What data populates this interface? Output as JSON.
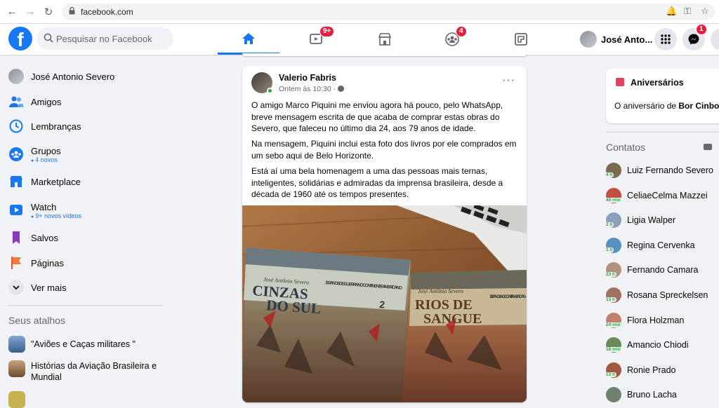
{
  "browser": {
    "url": "facebook.com"
  },
  "header": {
    "search_placeholder": "Pesquisar no Facebook",
    "watch_badge": "9+",
    "groups_badge": "4",
    "messenger_badge": "1",
    "profile_name": "José Anto..."
  },
  "sidebar": {
    "profile_name": "José Antonio Severo",
    "items": [
      {
        "label": "Amigos",
        "icon": "friends-icon"
      },
      {
        "label": "Lembranças",
        "icon": "memories-icon"
      },
      {
        "label": "Grupos",
        "sub": "4 novos",
        "icon": "groups-icon"
      },
      {
        "label": "Marketplace",
        "icon": "marketplace-icon"
      },
      {
        "label": "Watch",
        "sub": "9+ novos vídeos",
        "icon": "watch-icon"
      },
      {
        "label": "Salvos",
        "icon": "saved-icon"
      },
      {
        "label": "Páginas",
        "icon": "pages-icon"
      },
      {
        "label": "Ver mais",
        "icon": "chevron-down-icon"
      }
    ],
    "shortcuts_title": "Seus atalhos",
    "shortcuts": [
      {
        "label": "\"Aviões e Caças militares \""
      },
      {
        "label": "Histórias da Aviação Brasileira e Mundial"
      }
    ]
  },
  "post": {
    "author": "Valerio Fabris",
    "time": "Ontem às 10:30 ·",
    "more": "···",
    "paragraphs": [
      "O amigo Marco Piquini me enviou agora há pouco, pelo WhatsApp, breve mensagem escrita de que acaba de comprar estas obras do Severo, que faleceu no último dia 24, aos 79 anos de idade.",
      "Na mensagem, Piquini inclui esta foto dos livros por ele comprados em um sebo aqui de Belo Horizonte.",
      "Está aí uma bela homenagem a uma das pessoas mais ternas, inteligentes, solidárias e admiradas da imprensa brasileira, desde a década de 1960 até os tempos presentes."
    ],
    "book1": {
      "author": "José Antônio Severo",
      "series": "100 ANOS DE GUERRA NO CONTINENTE AMERICANO",
      "title_line1": "CINZAS",
      "title_line2": "DO SUL",
      "volume": "2"
    },
    "book2": {
      "author": "José Antônio Severo",
      "series": "100 ANOS NO CONTI AMERICAN",
      "title_line1": "RIOS DE",
      "title_line2": "SANGUE"
    }
  },
  "right": {
    "birthdays_title": "Aniversários",
    "birthday_text": "O aniversário de ",
    "birthday_name": "Bor Cinbor",
    "contacts_title": "Contatos",
    "contacts": [
      {
        "name": "Luiz Fernando Severo",
        "min": "4 h",
        "color": "#7a6a50"
      },
      {
        "name": "CeliaeCelma Mazzei",
        "min": "49 min",
        "color": "#c05040"
      },
      {
        "name": "Ligia Walper",
        "min": "2 h",
        "color": "#8aa0b8"
      },
      {
        "name": "Regina Cervenka",
        "min": "1 h",
        "color": "#5a90c0"
      },
      {
        "name": "Fernando Camara",
        "min": "23 h",
        "color": "#b09080"
      },
      {
        "name": "Rosana Spreckelsen",
        "min": "13 h",
        "color": "#a07060"
      },
      {
        "name": "Flora Holzman",
        "min": "24 min",
        "color": "#c08070"
      },
      {
        "name": "Amancio Chiodi",
        "min": "18 min",
        "color": "#6a8a5a"
      },
      {
        "name": "Ronie Prado",
        "min": "13 h",
        "color": "#a05a40"
      },
      {
        "name": "Bruno Lacha",
        "min": "",
        "color": "#708070"
      }
    ]
  },
  "colors": {
    "brand": "#1877f2",
    "badge": "#e41e3f",
    "online": "#31a24c"
  }
}
